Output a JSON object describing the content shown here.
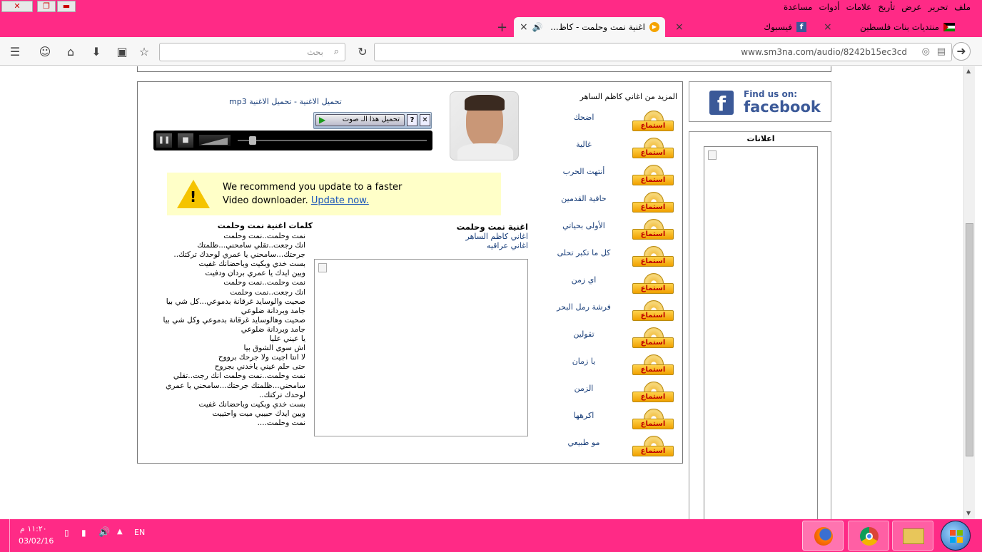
{
  "menubar": {
    "items": [
      "ملف",
      "تحرير",
      "عرض",
      "تأريخ",
      "علامات",
      "أدوات",
      "مساعدة"
    ]
  },
  "tabs": [
    {
      "label": "منتديات بنات فلسطين"
    },
    {
      "label": "فيسبوك"
    },
    {
      "label": "اغنية نمت وحلمت - كاظ..."
    }
  ],
  "navbar": {
    "url": "www.sm3na.com/audio/8242b15ec3cd",
    "search_placeholder": "بحث"
  },
  "player": {
    "download_link": "تحميل الاغنية - تحميل الاغنية mp3",
    "download_button": "تحميل هذا الـ صوت"
  },
  "notice": {
    "line1": "We recommend you update to a faster",
    "line2": "Video downloader.",
    "link": "Update now."
  },
  "song": {
    "title": "اغنية نمت وحلمت",
    "artist_link": "اغاني كاظم الساهر",
    "genre_link": "اغاني عراقيه"
  },
  "lyrics": {
    "heading": "كلمات اغنية نمت وحلمت",
    "lines": [
      "نمت وحلمت..نمت وحلمت",
      "انك رجعت..تقلي سامحني...ظلمتك",
      "جرحتك...سامحني يا عمري لوحدك تركتك..",
      "بست خدي وبكيت وباحضانك غفيت",
      "وبين ايدك يا عمري بردان ودفيت",
      "نمت وحلمت..نمت وحلمت",
      "انك رجعت..نمت وحلمت",
      "صحيت والوسايد غرقانة بدموعي...كل شي بيا",
      "جامد وبردانة ضلوعي",
      "صحيت وهالوساید غرقانة بدموعي وكل شي بيا",
      "جامد وبردانة ضلوعي",
      "يا عيني عليا",
      "اش سوى الشوق بيا",
      "لا انتا اجيت ولا جرحك برووح",
      "حتى حلم عيني ياخدني بجروح",
      "نمت وحلمت..نمت وحلمت انك رجت..تقلي",
      "سامحني...ظلمتك جرحتك...سامحني يا عمري",
      "لوحدك تركتك..",
      "بست خدي وبكيت وباحضانك غفيت",
      "وبين ايدك حبيبي ميت واحتييت",
      "نمت وحلمت...."
    ]
  },
  "more_songs": {
    "heading": "المزيد من اغاني كاظم الساهر",
    "listen_label": "استماع",
    "songs": [
      "اضحك",
      "غالية",
      "أنتهت الحرب",
      "حافية القدمين",
      "الأولى بحياتي",
      "كل ما تكبر تحلى",
      "اي زمن",
      "فرشة رمل البحر",
      "تقولين",
      "يا زمان",
      "الزمن",
      "اكرهها",
      "مو طبيعي"
    ]
  },
  "facebook": {
    "line1": "Find us on:",
    "line2": "facebook"
  },
  "ads": {
    "heading": "اعلانات"
  },
  "taskbar": {
    "lang": "EN",
    "time": "١١:٢٠ م",
    "date": "03/02/16"
  }
}
